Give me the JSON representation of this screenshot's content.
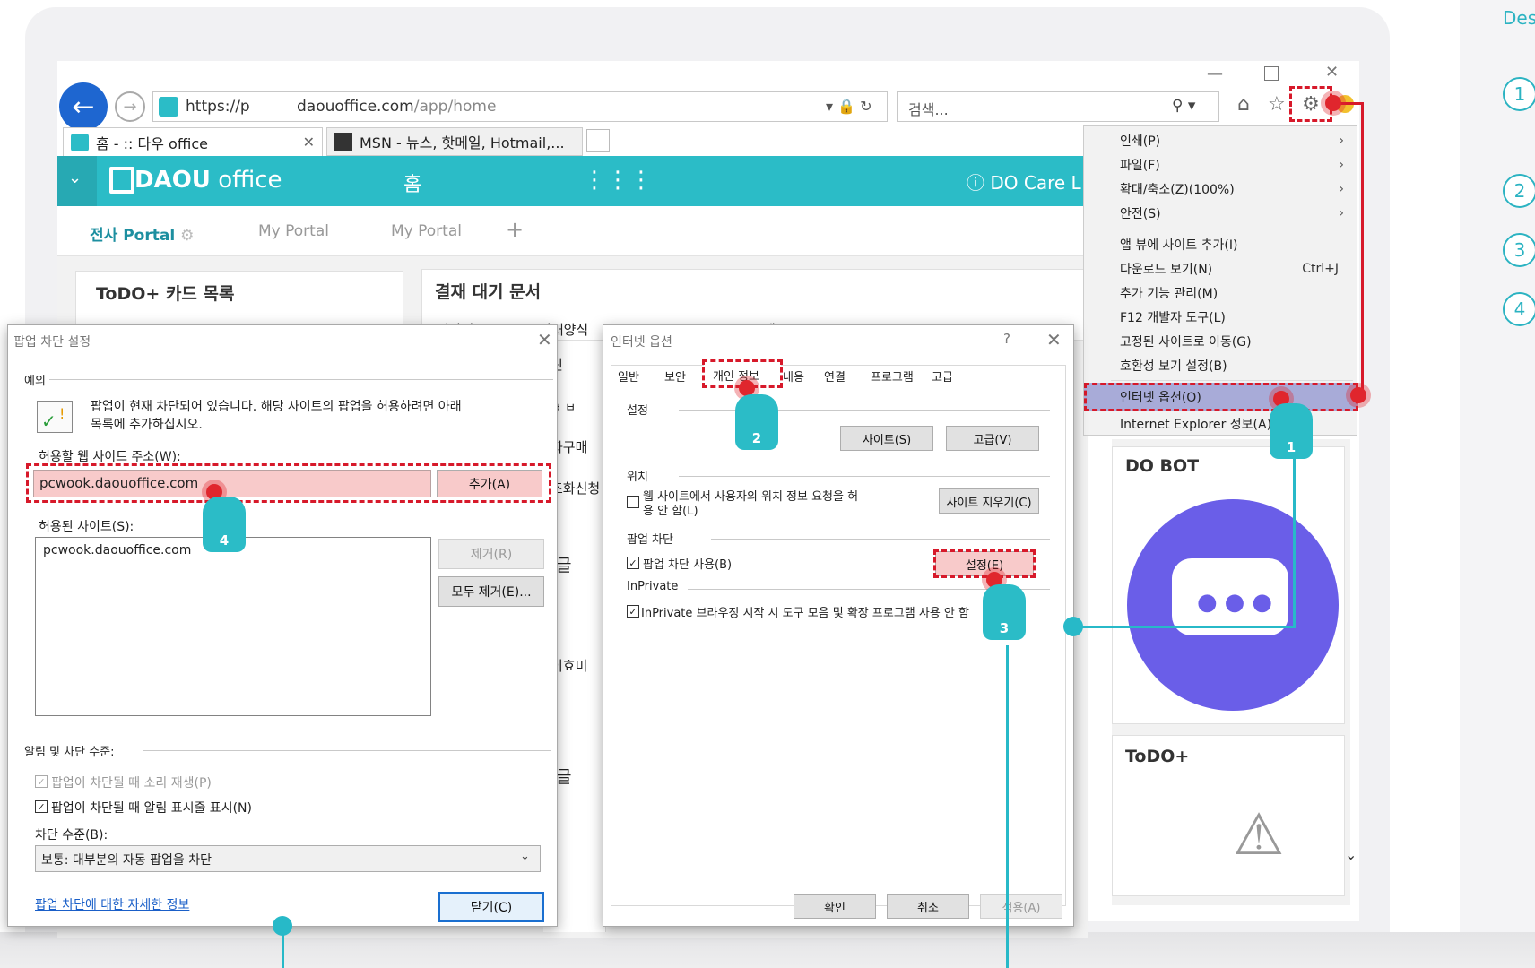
{
  "side": {
    "title": "Des",
    "steps": [
      "1",
      "2",
      "3",
      "4"
    ]
  },
  "browser": {
    "url_prefix": "https://p",
    "url_domain": "daouoffice.com",
    "url_path": "/app/home",
    "search_placeholder": "검색...",
    "tab1_title": "홈 - :: 다우 office",
    "tab2_title": "MSN - 뉴스, 핫메일, Hotmail,..."
  },
  "app": {
    "logo_bold": "DAOU",
    "logo_light": "office",
    "home_label": "홈",
    "docare": "DO Care L",
    "portal_tabs": [
      "전사 Portal",
      "My Portal",
      "My Portal"
    ],
    "todo_title": "ToDO+ 카드 목록",
    "approval_title": "결재 대기 문서",
    "approval_cols": [
      "기안일",
      "결재양식",
      "제목"
    ],
    "dobot_title": "DO BOT",
    "todo_plus_title": "ToDO+",
    "fragments": [
      "자구매",
      "조화신청",
      "글",
      "이효미",
      "글",
      "신",
      "ㅂ ㅂ"
    ]
  },
  "tools_menu": {
    "items": [
      {
        "label": "인쇄(P)",
        "arrow": "›"
      },
      {
        "label": "파일(F)",
        "arrow": "›"
      },
      {
        "label": "확대/축소(Z)(100%)",
        "arrow": "›"
      },
      {
        "label": "안전(S)",
        "arrow": "›"
      },
      {
        "label": "앱 뷰에 사이트 추가(I)"
      },
      {
        "label": "다운로드 보기(N)",
        "shortcut": "Ctrl+J"
      },
      {
        "label": "추가 기능 관리(M)"
      },
      {
        "label": "F12 개발자 도구(L)"
      },
      {
        "label": "고정된 사이트로 이동(G)"
      },
      {
        "label": "호환성 보기 설정(B)"
      },
      {
        "label": "인터넷 옵션(O)"
      },
      {
        "label": "Internet Explorer 정보(A)"
      }
    ]
  },
  "popup_dialog": {
    "title": "팝업 차단 설정",
    "exceptions_label": "예외",
    "info_line1": "팝업이 현재 차단되어 있습니다. 해당 사이트의 팝업을 허용하려면 아래",
    "info_line2": "목록에 추가하십시오.",
    "address_label": "허용할 웹 사이트 주소(W):",
    "address_value": "pcwook.daouoffice.com",
    "add_button": "추가(A)",
    "allowed_label": "허용된 사이트(S):",
    "allowed_sites": [
      "pcwook.daouoffice.com"
    ],
    "remove_button": "제거(R)",
    "remove_all_button": "모두 제거(E)...",
    "notify_label": "알림 및 차단 수준:",
    "sound_label": "팝업이 차단될 때 소리 재생(P)",
    "notify_bar_label": "팝업이 차단될 때 알림 표시줄 표시(N)",
    "level_label": "차단 수준(B):",
    "level_value": "보통: 대부분의 자동 팝업을 차단",
    "more_info_link": "팝업 차단에 대한 자세한 정보",
    "close_button": "닫기(C)"
  },
  "options_dialog": {
    "title": "인터넷 옵션",
    "help": "?",
    "tabs": [
      "일반",
      "보안",
      "개인 정보",
      "내용",
      "연결",
      "프로그램",
      "고급"
    ],
    "settings_label": "설정",
    "sites_button": "사이트(S)",
    "advanced_button": "고급(V)",
    "location_label": "위치",
    "location_check_line1": "웹 사이트에서 사용자의 위치 정보 요청을 허",
    "location_check_line2": "용 안 함(L)",
    "clear_sites_button": "사이트 지우기(C)",
    "popup_label": "팝업 차단",
    "popup_check": "팝업 차단 사용(B)",
    "popup_settings_button": "설정(E)",
    "inprivate_label": "InPrivate",
    "inprivate_check": "InPrivate 브라우징 시작 시 도구 모음 및 확장 프로그램 사용 안 함",
    "ok_button": "확인",
    "cancel_button": "취소",
    "apply_button": "적용(A)"
  },
  "callouts": [
    "1",
    "2",
    "3",
    "4"
  ],
  "colors": {
    "accent": "#2bbcc7",
    "highlight_red": "#d7192a",
    "menu_highlight": "#a8abd8",
    "bot_purple": "#6a5ee8"
  }
}
